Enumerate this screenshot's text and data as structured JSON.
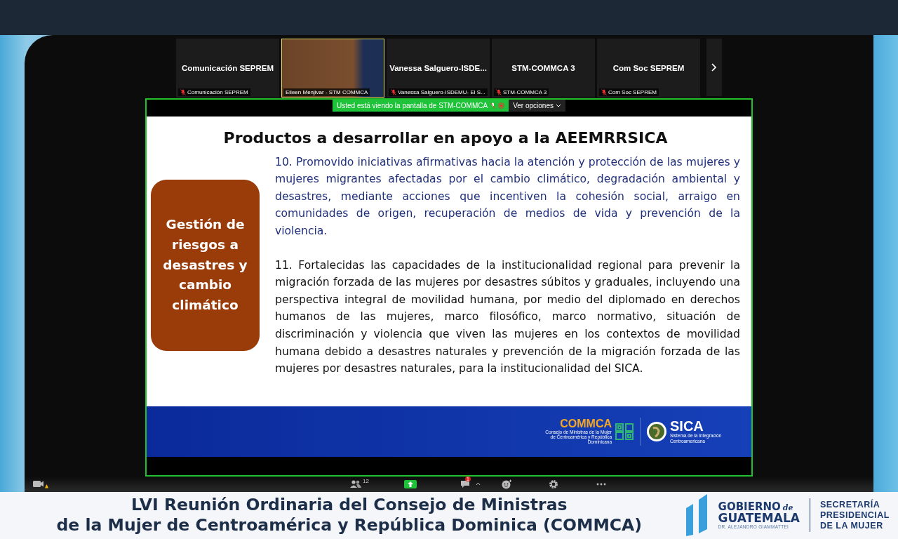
{
  "participants": [
    {
      "kind": "name",
      "title": "Comunicación SEPREM",
      "label": "Comunicación SEPREM",
      "muted": true,
      "speaking": false
    },
    {
      "kind": "video",
      "label": "Eileen Menjivar - STM COMMCA",
      "muted": false,
      "speaking": true
    },
    {
      "kind": "name",
      "title": "Vanessa Salguero-ISDE...",
      "label": "Vanessa Salguero-ISDEMU- El S...",
      "muted": true,
      "speaking": false
    },
    {
      "kind": "name",
      "title": "STM-COMMCA 3",
      "label": "STM-COMMCA 3",
      "muted": true,
      "speaking": false
    },
    {
      "kind": "name",
      "title": "Com Soc SEPREM",
      "label": "Com Soc SEPREM",
      "muted": true,
      "speaking": false
    }
  ],
  "share_banner": {
    "text": "Usted está viendo la pantalla de STM-COMMCA",
    "options": "Ver opciones"
  },
  "slide": {
    "title": "Productos  a desarrollar en apoyo a la AEEMRRSICA",
    "category": "Gestión de riesgos a desastres y cambio climático",
    "paragraphs": [
      {
        "text": "10. Promovido iniciativas afirmativas hacia la atención y protección de las mujeres y mujeres migrantes afectadas por el cambio climático, degradación ambiental y desastres, mediante acciones que incentiven la cohesión social, arraigo en comunidades de origen, recuperación de medios de vida y prevención de la violencia.",
        "color": "#1f2f7a"
      },
      {
        "text": "11. Fortalecidas las capacidades de la institucionalidad regional para prevenir la migración forzada de las mujeres por desastres súbitos y graduales, incluyendo una perspectiva integral de movilidad humana, por medio del diplomado en derechos humanos de las mujeres, marco filosófico, marco normativo, situación de discriminación y violencia que viven las mujeres en los contextos de movilidad humana debido a desastres naturales y prevención de la migración forzada de las mujeres por desastres naturales, para la institucionalidad del SICA.",
        "color": "#111111"
      }
    ],
    "commca": {
      "name": "COMMCA",
      "subtitle": "Consejo de Ministras de la Mujer de Centroamérica y República Dominicana"
    },
    "sica": {
      "name": "SICA",
      "subtitle": "Sistema de la Integración Centroamericana"
    }
  },
  "toolbar": {
    "participants_count": "12",
    "chat_badge": "1"
  },
  "banner": {
    "title_lines": [
      "LVI Reunión Ordinaria del Consejo de Ministras",
      "de la Mujer de Centroamérica y República Dominica (COMMCA)"
    ],
    "gov": {
      "line1": "GOBIERNO",
      "de": "de",
      "line2": "GUATEMALA",
      "sub": "DR. ALEJANDRO GIAMMATTEI"
    },
    "secretaria": [
      "SECRETARÍA",
      "PRESIDENCIAL",
      "DE LA MUJER"
    ]
  }
}
